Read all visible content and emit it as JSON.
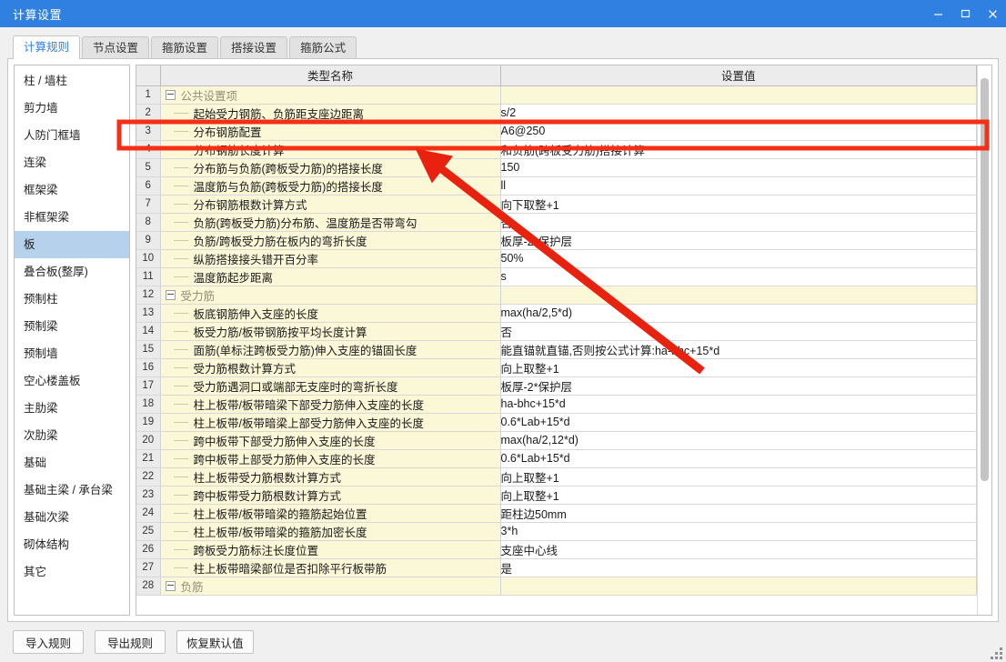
{
  "window": {
    "title": "计算设置",
    "controls": [
      {
        "name": "minimize",
        "glyph": "—"
      },
      {
        "name": "maximize",
        "glyph": "▢"
      },
      {
        "name": "close",
        "glyph": "✕"
      }
    ]
  },
  "tabs": [
    {
      "label": "计算规则",
      "active": true
    },
    {
      "label": "节点设置",
      "active": false
    },
    {
      "label": "箍筋设置",
      "active": false
    },
    {
      "label": "搭接设置",
      "active": false
    },
    {
      "label": "箍筋公式",
      "active": false
    }
  ],
  "sidebar": {
    "items": [
      {
        "label": "柱 / 墙柱",
        "selected": false
      },
      {
        "label": "剪力墙",
        "selected": false
      },
      {
        "label": "人防门框墙",
        "selected": false
      },
      {
        "label": "连梁",
        "selected": false
      },
      {
        "label": "框架梁",
        "selected": false
      },
      {
        "label": "非框架梁",
        "selected": false
      },
      {
        "label": "板",
        "selected": true
      },
      {
        "label": "叠合板(整厚)",
        "selected": false
      },
      {
        "label": "预制柱",
        "selected": false
      },
      {
        "label": "预制梁",
        "selected": false
      },
      {
        "label": "预制墙",
        "selected": false
      },
      {
        "label": "空心楼盖板",
        "selected": false
      },
      {
        "label": "主肋梁",
        "selected": false
      },
      {
        "label": "次肋梁",
        "selected": false
      },
      {
        "label": "基础",
        "selected": false
      },
      {
        "label": "基础主梁 / 承台梁",
        "selected": false
      },
      {
        "label": "基础次梁",
        "selected": false
      },
      {
        "label": "砌体结构",
        "selected": false
      },
      {
        "label": "其它",
        "selected": false
      }
    ]
  },
  "table": {
    "headers": {
      "num": "",
      "name": "类型名称",
      "value": "设置值"
    },
    "rows": [
      {
        "num": "1",
        "group": true,
        "name": "公共设置项",
        "value": ""
      },
      {
        "num": "2",
        "group": false,
        "name": "起始受力钢筋、负筋距支座边距离",
        "value": "s/2"
      },
      {
        "num": "3",
        "group": false,
        "name": "分布钢筋配置",
        "value": "A6@250",
        "highlighted": true
      },
      {
        "num": "4",
        "group": false,
        "name": "分布钢筋长度计算",
        "value": "和负筋(跨板受力筋)搭接计算"
      },
      {
        "num": "5",
        "group": false,
        "name": "分布筋与负筋(跨板受力筋)的搭接长度",
        "value": "150"
      },
      {
        "num": "6",
        "group": false,
        "name": "温度筋与负筋(跨板受力筋)的搭接长度",
        "value": "ll"
      },
      {
        "num": "7",
        "group": false,
        "name": "分布钢筋根数计算方式",
        "value": "向下取整+1"
      },
      {
        "num": "8",
        "group": false,
        "name": "负筋(跨板受力筋)分布筋、温度筋是否带弯勾",
        "value": "否"
      },
      {
        "num": "9",
        "group": false,
        "name": "负筋/跨板受力筋在板内的弯折长度",
        "value": "板厚-2*保护层"
      },
      {
        "num": "10",
        "group": false,
        "name": "纵筋搭接接头错开百分率",
        "value": "50%"
      },
      {
        "num": "11",
        "group": false,
        "name": "温度筋起步距离",
        "value": "s"
      },
      {
        "num": "12",
        "group": true,
        "name": "受力筋",
        "value": ""
      },
      {
        "num": "13",
        "group": false,
        "name": "板底钢筋伸入支座的长度",
        "value": "max(ha/2,5*d)"
      },
      {
        "num": "14",
        "group": false,
        "name": "板受力筋/板带钢筋按平均长度计算",
        "value": "否"
      },
      {
        "num": "15",
        "group": false,
        "name": "面筋(单标注跨板受力筋)伸入支座的锚固长度",
        "value": "能直锚就直锚,否则按公式计算:ha-bhc+15*d"
      },
      {
        "num": "16",
        "group": false,
        "name": "受力筋根数计算方式",
        "value": "向上取整+1"
      },
      {
        "num": "17",
        "group": false,
        "name": "受力筋遇洞口或端部无支座时的弯折长度",
        "value": "板厚-2*保护层"
      },
      {
        "num": "18",
        "group": false,
        "name": "柱上板带/板带暗梁下部受力筋伸入支座的长度",
        "value": "ha-bhc+15*d"
      },
      {
        "num": "19",
        "group": false,
        "name": "柱上板带/板带暗梁上部受力筋伸入支座的长度",
        "value": "0.6*Lab+15*d"
      },
      {
        "num": "20",
        "group": false,
        "name": "跨中板带下部受力筋伸入支座的长度",
        "value": "max(ha/2,12*d)"
      },
      {
        "num": "21",
        "group": false,
        "name": "跨中板带上部受力筋伸入支座的长度",
        "value": "0.6*Lab+15*d"
      },
      {
        "num": "22",
        "group": false,
        "name": "柱上板带受力筋根数计算方式",
        "value": "向上取整+1"
      },
      {
        "num": "23",
        "group": false,
        "name": "跨中板带受力筋根数计算方式",
        "value": "向上取整+1"
      },
      {
        "num": "24",
        "group": false,
        "name": "柱上板带/板带暗梁的箍筋起始位置",
        "value": "距柱边50mm"
      },
      {
        "num": "25",
        "group": false,
        "name": "柱上板带/板带暗梁的箍筋加密长度",
        "value": "3*h"
      },
      {
        "num": "26",
        "group": false,
        "name": "跨板受力筋标注长度位置",
        "value": "支座中心线"
      },
      {
        "num": "27",
        "group": false,
        "name": "柱上板带暗梁部位是否扣除平行板带筋",
        "value": "是"
      },
      {
        "num": "28",
        "group": true,
        "name": "负筋",
        "value": ""
      }
    ]
  },
  "footer": {
    "buttons": [
      {
        "label": "导入规则",
        "name": "import-rules-button"
      },
      {
        "label": "导出规则",
        "name": "export-rules-button"
      },
      {
        "label": "恢复默认值",
        "name": "restore-defaults-button"
      }
    ]
  },
  "annotations": {
    "highlight_color": "#f42f16",
    "arrow_color": "#e8220f",
    "highlight_row_num": "3"
  }
}
